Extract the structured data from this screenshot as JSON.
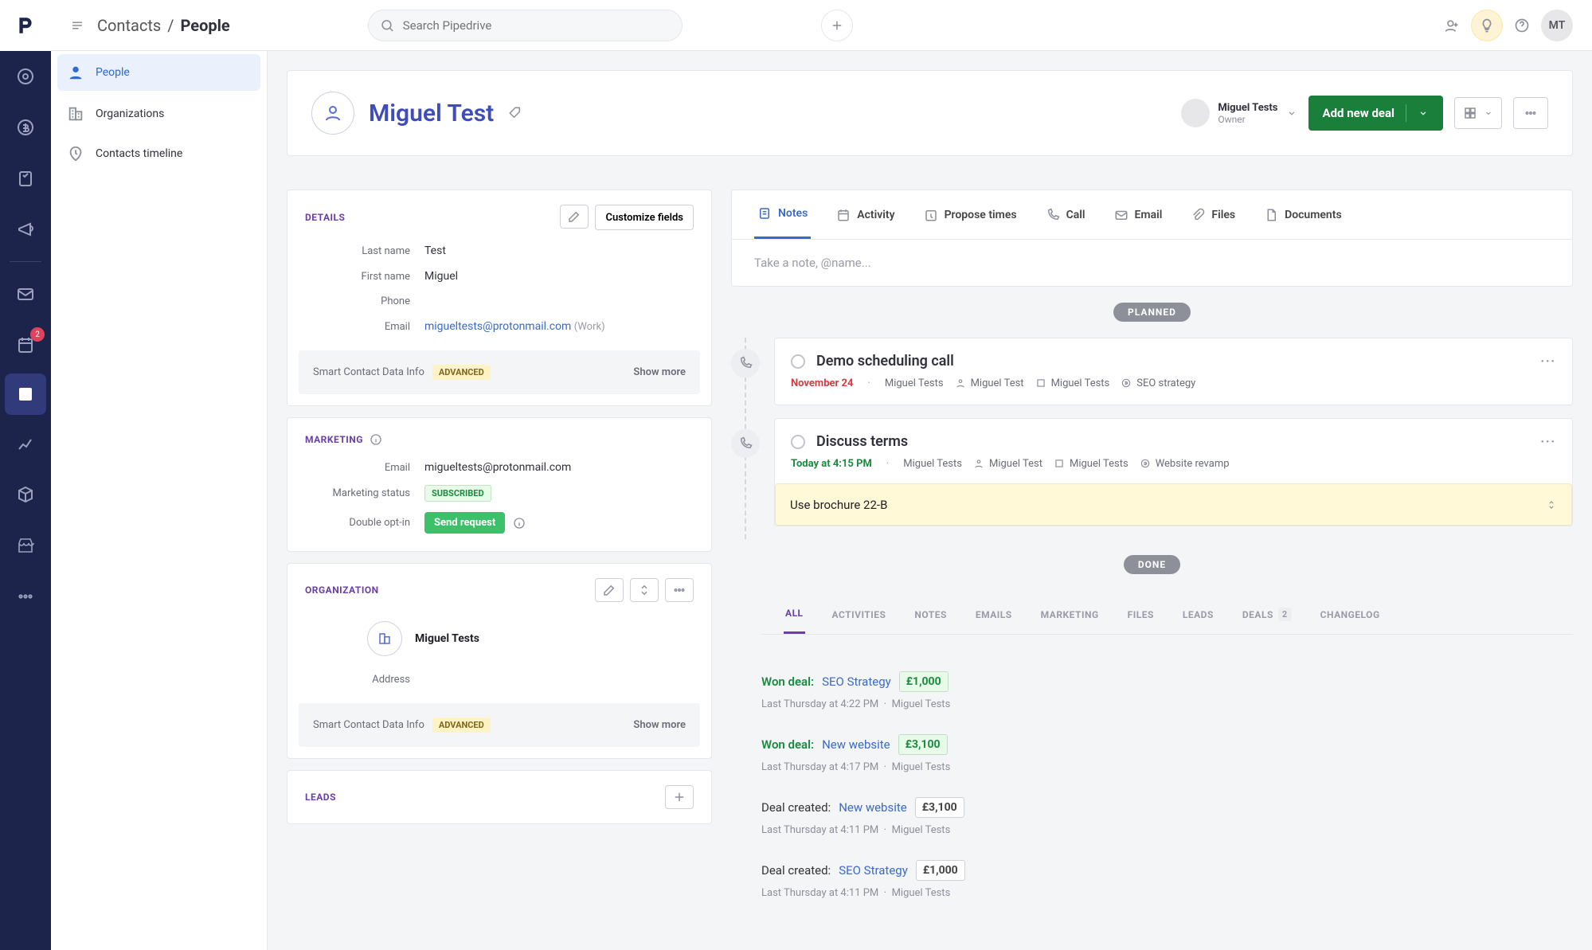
{
  "topbar": {
    "breadcrumb1": "Contacts",
    "breadcrumb2": "People",
    "search_placeholder": "Search Pipedrive",
    "avatar_initials": "MT"
  },
  "rail": {
    "badge_count": "2"
  },
  "subnav": {
    "items": [
      {
        "label": "People",
        "active": true
      },
      {
        "label": "Organizations",
        "active": false
      },
      {
        "label": "Contacts timeline",
        "active": false
      }
    ]
  },
  "person": {
    "name": "Miguel Test",
    "owner_name": "Miguel Tests",
    "owner_role": "Owner",
    "add_deal_label": "Add new deal"
  },
  "details": {
    "title": "DETAILS",
    "customize_label": "Customize fields",
    "fields": {
      "last_name_label": "Last name",
      "last_name_value": "Test",
      "first_name_label": "First name",
      "first_name_value": "Miguel",
      "phone_label": "Phone",
      "phone_value": "",
      "email_label": "Email",
      "email_value": "migueltests@protonmail.com",
      "email_type": "(Work)"
    },
    "smart_label": "Smart Contact Data Info",
    "advanced": "ADVANCED",
    "show_more": "Show more"
  },
  "marketing": {
    "title": "MARKETING",
    "email_label": "Email",
    "email_value": "migueltests@protonmail.com",
    "status_label": "Marketing status",
    "status_badge": "SUBSCRIBED",
    "optin_label": "Double opt-in",
    "send_label": "Send request"
  },
  "organization": {
    "title": "ORGANIZATION",
    "name": "Miguel Tests",
    "address_label": "Address",
    "smart_label": "Smart Contact Data Info",
    "advanced": "ADVANCED",
    "show_more": "Show more"
  },
  "leads": {
    "title": "LEADS"
  },
  "tabs": {
    "notes": "Notes",
    "activity": "Activity",
    "propose": "Propose times",
    "call": "Call",
    "email": "Email",
    "files": "Files",
    "documents": "Documents",
    "note_placeholder": "Take a note, @name..."
  },
  "sections": {
    "planned": "PLANNED",
    "done": "DONE"
  },
  "activities": [
    {
      "title": "Demo scheduling call",
      "date": "November 24",
      "date_class": "red",
      "owner": "Miguel Tests",
      "person": "Miguel Test",
      "org": "Miguel Tests",
      "deal": "SEO strategy"
    },
    {
      "title": "Discuss terms",
      "date": "Today at 4:15 PM",
      "date_class": "green",
      "owner": "Miguel Tests",
      "person": "Miguel Test",
      "org": "Miguel Tests",
      "deal": "Website revamp",
      "note": "Use brochure 22-B"
    }
  ],
  "filters": {
    "all": "ALL",
    "activities": "ACTIVITIES",
    "notes": "NOTES",
    "emails": "EMAILS",
    "marketing": "MARKETING",
    "files": "FILES",
    "leads": "LEADS",
    "deals": "DEALS",
    "deals_count": "2",
    "changelog": "CHANGELOG"
  },
  "done_items": [
    {
      "prefix": "Won deal:",
      "prefix_class": "green",
      "deal": "SEO Strategy",
      "amount": "£1,000",
      "amount_class": "",
      "time": "Last Thursday at 4:22 PM",
      "owner": "Miguel Tests"
    },
    {
      "prefix": "Won deal:",
      "prefix_class": "green",
      "deal": "New website",
      "amount": "£3,100",
      "amount_class": "",
      "time": "Last Thursday at 4:17 PM",
      "owner": "Miguel Tests"
    },
    {
      "prefix": "Deal created:",
      "prefix_class": "plain",
      "deal": "New website",
      "amount": "£3,100",
      "amount_class": "gray",
      "time": "Last Thursday at 4:11 PM",
      "owner": "Miguel Tests"
    },
    {
      "prefix": "Deal created:",
      "prefix_class": "plain",
      "deal": "SEO Strategy",
      "amount": "£1,000",
      "amount_class": "gray",
      "time": "Last Thursday at 4:11 PM",
      "owner": "Miguel Tests"
    }
  ]
}
